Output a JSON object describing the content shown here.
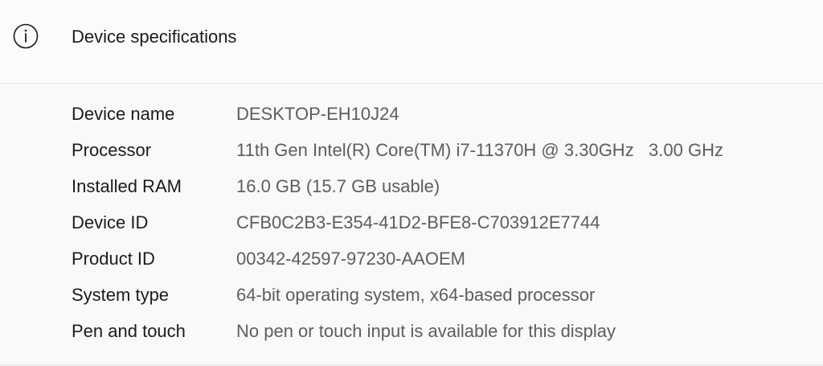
{
  "header": {
    "icon": "info-icon",
    "title": "Device specifications"
  },
  "specs": [
    {
      "label": "Device name",
      "value": "DESKTOP-EH10J24"
    },
    {
      "label": "Processor",
      "value": "11th Gen Intel(R) Core(TM) i7-11370H @ 3.30GHz   3.00 GHz"
    },
    {
      "label": "Installed RAM",
      "value": "16.0 GB (15.7 GB usable)"
    },
    {
      "label": "Device ID",
      "value": "CFB0C2B3-E354-41D2-BFE8-C703912E7744"
    },
    {
      "label": "Product ID",
      "value": "00342-42597-97230-AAOEM"
    },
    {
      "label": "System type",
      "value": "64-bit operating system, x64-based processor"
    },
    {
      "label": "Pen and touch",
      "value": "No pen or touch input is available for this display"
    }
  ]
}
